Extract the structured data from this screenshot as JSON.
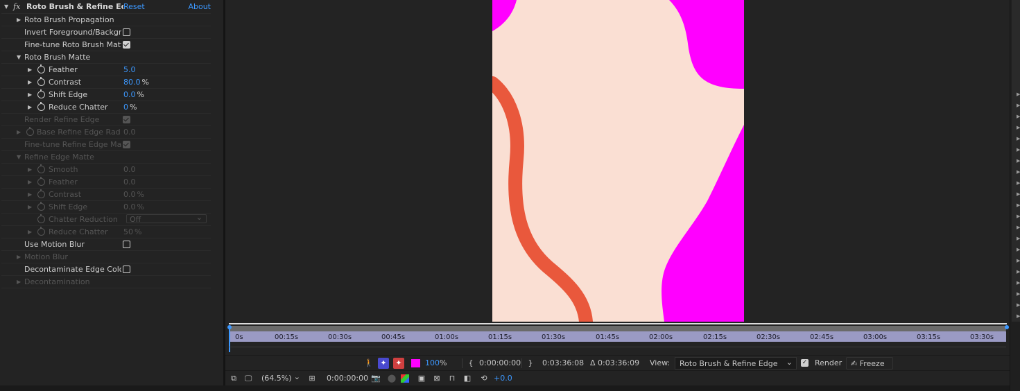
{
  "effect": {
    "title": "Roto Brush & Refine Edge",
    "reset_label": "Reset",
    "about_label": "About"
  },
  "props": {
    "roto_propagation": "Roto Brush Propagation",
    "invert_fg_bg": "Invert Foreground/Backgrou",
    "finetune_roto_matte": "Fine-tune Roto Brush Matte",
    "roto_matte": "Roto Brush Matte",
    "feather_label": "Feather",
    "feather_value": "5.0",
    "contrast_label": "Contrast",
    "contrast_value": "80.0",
    "contrast_unit": "%",
    "shift_edge_label": "Shift Edge",
    "shift_edge_value": "0.0",
    "shift_edge_unit": "%",
    "reduce_chatter_label": "Reduce Chatter",
    "reduce_chatter_value": "0",
    "reduce_chatter_unit": "%",
    "render_refine_edge": "Render Refine Edge",
    "base_refine_radius_label": "Base Refine Edge Radiu",
    "base_refine_radius_value": "0.0",
    "finetune_refine_matte": "Fine-tune Refine Edge Matt",
    "refine_edge_matte": "Refine Edge Matte",
    "re_smooth_label": "Smooth",
    "re_smooth_value": "0.0",
    "re_feather_label": "Feather",
    "re_feather_value": "0.0",
    "re_contrast_label": "Contrast",
    "re_contrast_value": "0.0",
    "re_contrast_unit": "%",
    "re_shift_label": "Shift Edge",
    "re_shift_value": "0.0",
    "re_shift_unit": "%",
    "re_chatter_reduction_label": "Chatter Reduction",
    "re_chatter_reduction_value": "Off",
    "re_reduce_chatter_label": "Reduce Chatter",
    "re_reduce_chatter_value": "50",
    "re_reduce_chatter_unit": "%",
    "use_motion_blur": "Use Motion Blur",
    "motion_blur": "Motion Blur",
    "decontaminate_colors": "Decontaminate Edge Colors",
    "decontamination": "Decontamination"
  },
  "timeline": {
    "ticks": [
      "0s",
      "00:15s",
      "00:30s",
      "00:45s",
      "01:00s",
      "01:15s",
      "01:30s",
      "01:45s",
      "02:00s",
      "02:15s",
      "02:30s",
      "02:45s",
      "03:00s",
      "03:15s",
      "03:30s"
    ]
  },
  "toolbar1": {
    "opacity_value": "100",
    "opacity_unit": "%",
    "in_time": "0:00:00:00",
    "out_time": "0:03:36:08",
    "duration": "Δ 0:03:36:09",
    "view_label": "View:",
    "view_value": "Roto Brush & Refine Edge",
    "render_label": "Render",
    "freeze_label": "Freeze"
  },
  "toolbar2": {
    "zoom": "(64.5%)",
    "timecode": "0:00:00:00",
    "exposure": "+0.0"
  },
  "colors": {
    "accent": "#3c98ff",
    "magenta": "#ff00ff",
    "skin": "#fadfd3",
    "stroke": "#e9583c",
    "ruler": "#9a9ac4"
  }
}
